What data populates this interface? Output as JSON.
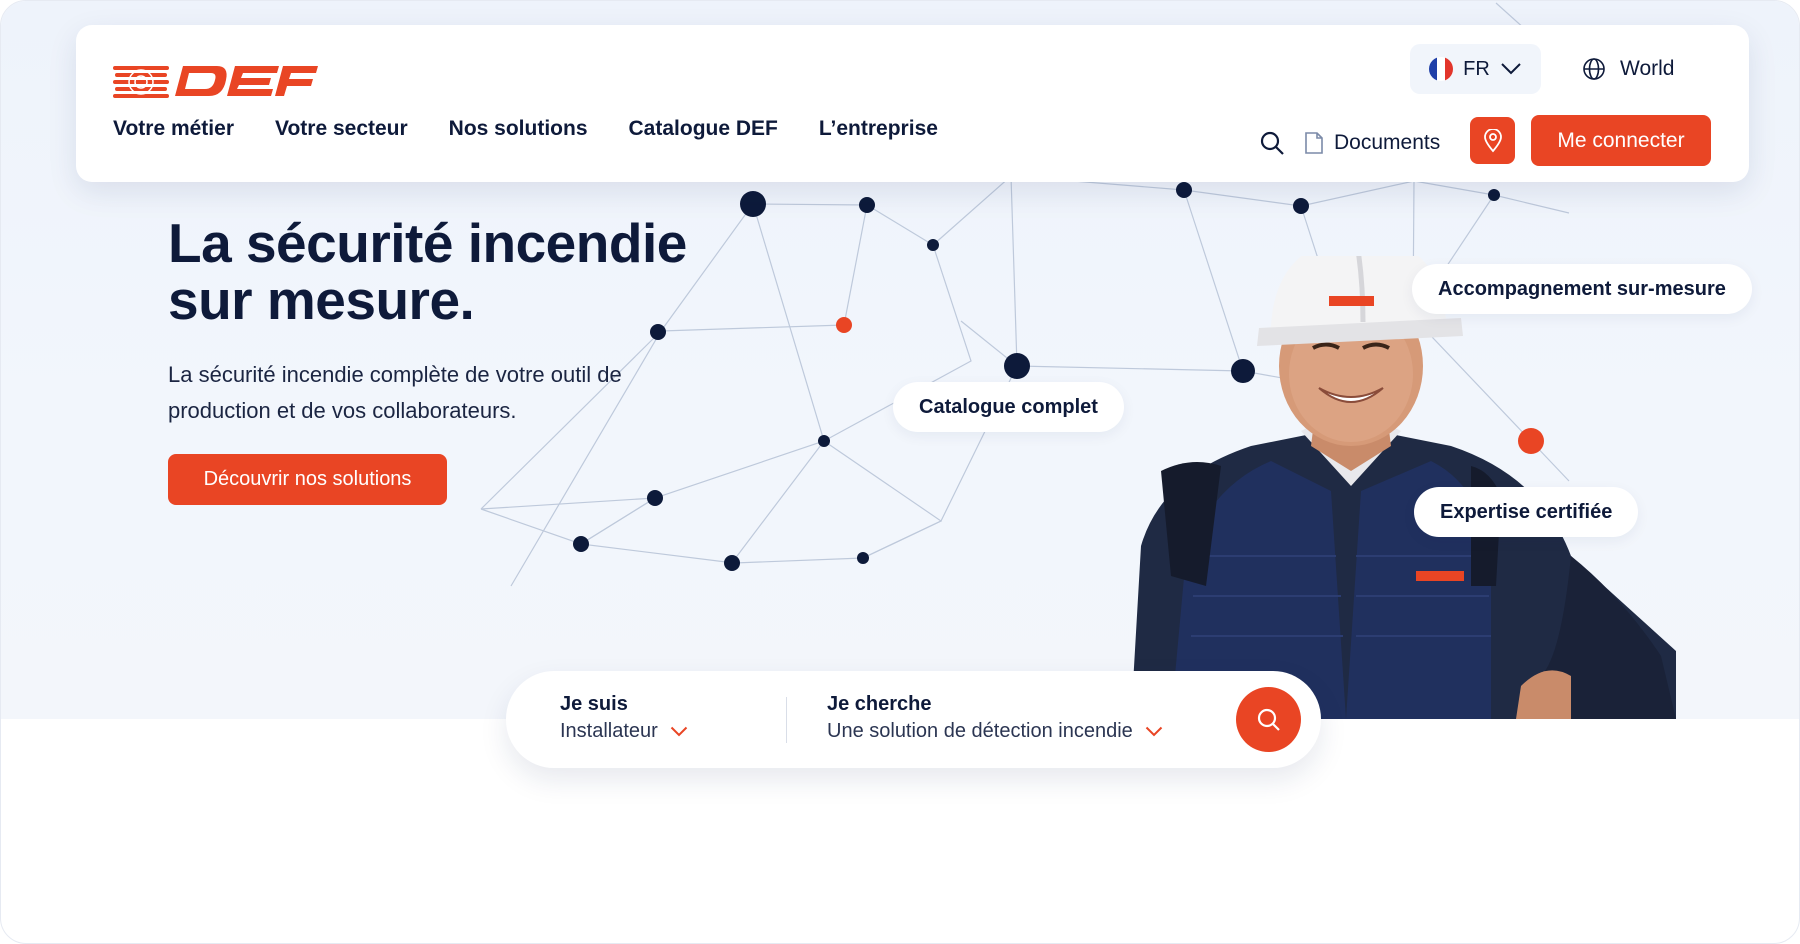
{
  "brand": {
    "name": "DEF",
    "accent_color": "#e94524",
    "text_color": "#0e1a3a"
  },
  "header": {
    "nav": [
      {
        "label": "Votre métier"
      },
      {
        "label": "Votre secteur"
      },
      {
        "label": "Nos solutions"
      },
      {
        "label": "Catalogue DEF"
      },
      {
        "label": "L’entreprise"
      }
    ],
    "language": {
      "code": "FR",
      "flag_icon": "france-flag-icon"
    },
    "world_label": "World",
    "documents_label": "Documents",
    "login_label": "Me connecter"
  },
  "hero": {
    "title": "La sécurité incendie sur mesure.",
    "subtitle": "La sécurité incendie complète de votre outil de production et de vos collaborateurs.",
    "cta_label": "Découvrir nos solutions",
    "pills": {
      "accompagnement": "Accompagnement sur-mesure",
      "catalogue": "Catalogue complet",
      "expertise": "Expertise certifiée"
    }
  },
  "search": {
    "who_label": "Je suis",
    "who_value": "Installateur",
    "what_label": "Je cherche",
    "what_value": "Une solution de détection incendie"
  }
}
